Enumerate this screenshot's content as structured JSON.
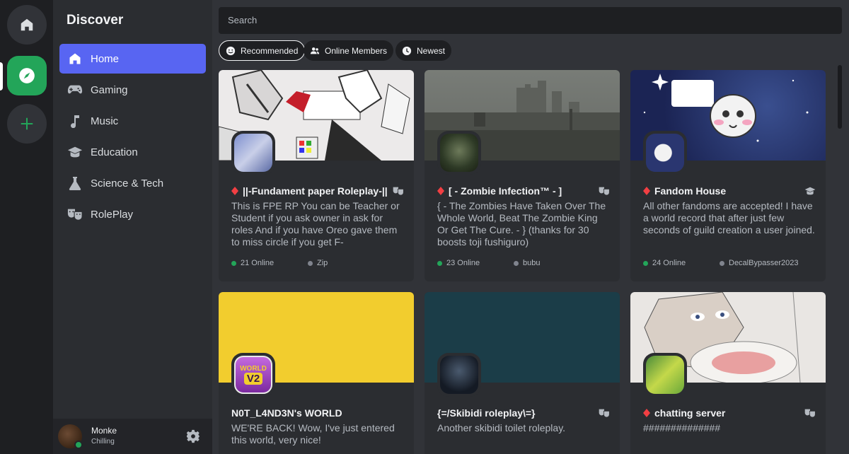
{
  "sidebar": {
    "title": "Discover",
    "items": [
      {
        "label": "Home",
        "icon": "home-icon"
      },
      {
        "label": "Gaming",
        "icon": "controller-icon"
      },
      {
        "label": "Music",
        "icon": "music-note-icon"
      },
      {
        "label": "Education",
        "icon": "graduation-cap-icon"
      },
      {
        "label": "Science & Tech",
        "icon": "flask-icon"
      },
      {
        "label": "RolePlay",
        "icon": "theater-masks-icon"
      }
    ]
  },
  "user": {
    "name": "Monke",
    "status": "Chilling"
  },
  "search": {
    "placeholder": "Search"
  },
  "filters": [
    {
      "label": "Recommended",
      "icon": "smiley-icon",
      "active": true
    },
    {
      "label": "Online Members",
      "icon": "people-icon"
    },
    {
      "label": "Newest",
      "icon": "clock-icon"
    }
  ],
  "cards": [
    {
      "title": "||-Fundament paper Roleplay-||",
      "desc": "This is FPE RP You can be Teacher or Student if you ask owner in ask for roles And if you have Oreo gave them to miss circle if you get F-",
      "online": "21 Online",
      "owner": "Zip"
    },
    {
      "title": "[ - Zombie Infection™ - ]",
      "desc": "{ - The Zombies Have Taken Over The Whole World, Beat The Zombie King Or Get The Cure. - } (thanks for 30 boosts toji fushiguro)",
      "online": "23 Online",
      "owner": "bubu"
    },
    {
      "title": "Fandom House",
      "desc": "All other fandoms are accepted! I have a world record that after just few seconds of guild creation a user joined.",
      "online": "24 Online",
      "owner": "DecalBypasser2023"
    },
    {
      "title": "N0T_L4ND3N's WORLD",
      "desc": "WE'RE BACK! Wow, I've just entered this world, very nice!",
      "icon_text_1": "WORLD",
      "icon_text_2": "V2"
    },
    {
      "title": "{=/Skibidi roleplay\\=}",
      "desc": "Another skibidi toilet roleplay."
    },
    {
      "title": "chatting server",
      "desc": "##############"
    }
  ],
  "colors": {
    "accent": "#5865f2",
    "online": "#23a559",
    "premium_gem": "#f23f43",
    "banner_yellow": "#f2cd2e",
    "banner_teal": "#1b3d48"
  }
}
